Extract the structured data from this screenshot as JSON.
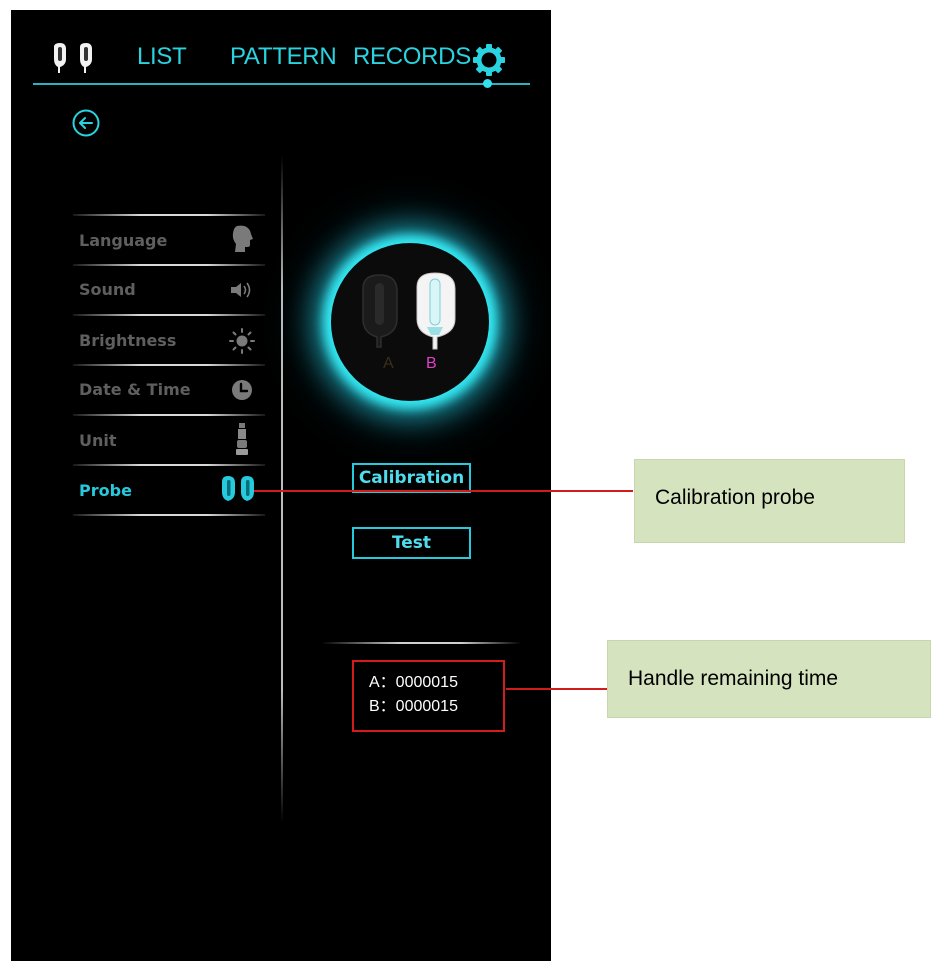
{
  "nav": {
    "probe_icon": "dual-probe-icon",
    "list": "LIST",
    "pattern": "PATTERN",
    "records": "RECORDS",
    "settings_icon": "gear-icon"
  },
  "back_icon": "back-arrow-icon",
  "settings_menu": [
    {
      "label": "Language",
      "icon": "head-profile-icon",
      "active": false
    },
    {
      "label": "Sound",
      "icon": "speaker-icon",
      "active": false
    },
    {
      "label": "Brightness",
      "icon": "sun-icon",
      "active": false
    },
    {
      "label": "Date & Time",
      "icon": "clock-icon",
      "active": false
    },
    {
      "label": "Unit",
      "icon": "device-unit-icon",
      "active": false
    },
    {
      "label": "Probe",
      "icon": "probe-pair-icon",
      "active": true
    }
  ],
  "probe_panel": {
    "probe_a_label": "A",
    "probe_b_label": "B",
    "calibration_button": "Calibration",
    "test_button": "Test",
    "remaining": {
      "a": "A：0000015",
      "b": "B：0000015"
    }
  },
  "annotations": {
    "calibration": "Calibration probe",
    "remaining": "Handle remaining time"
  },
  "colors": {
    "accent": "#27c9dd",
    "menu_inactive": "#5f5f5f",
    "probe_b_label": "#e040c8",
    "annotation_box": "#d6e3bf",
    "annotation_line": "#d21b1b"
  }
}
